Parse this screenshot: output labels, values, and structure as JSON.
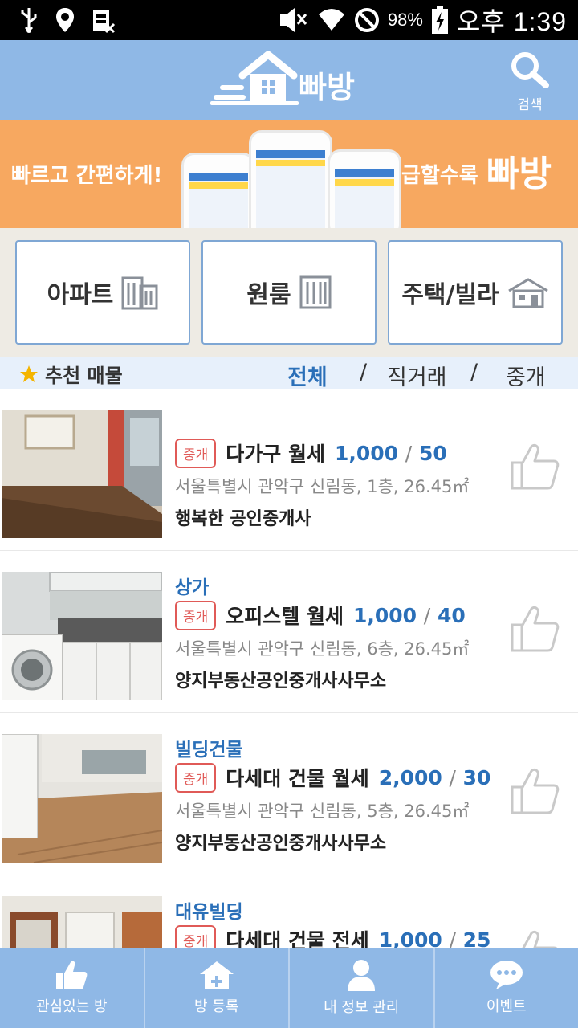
{
  "status_bar": {
    "battery": "98%",
    "time": "오후 1:39"
  },
  "header": {
    "logo_text": "빠방",
    "search_label": "검색"
  },
  "banner": {
    "left_text": "빠르고 간편하게!",
    "right_text": "급할수록",
    "brand": "빠방"
  },
  "categories": [
    {
      "label": "아파트"
    },
    {
      "label": "원룸"
    },
    {
      "label": "주택/빌라"
    }
  ],
  "filter": {
    "recommend_label": "추천 매물",
    "options": [
      "전체",
      "직거래",
      "중개"
    ],
    "active": "전체"
  },
  "listings": [
    {
      "building": "",
      "badge": "중개",
      "type": "다가구 월세",
      "deposit": "1,000",
      "rent": "50",
      "address": "서울특별시 관악구 신림동,   1층,   26.45㎡",
      "agent": "행복한 공인중개사"
    },
    {
      "building": "상가",
      "badge": "중개",
      "type": "오피스텔 월세",
      "deposit": "1,000",
      "rent": "40",
      "address": "서울특별시 관악구 신림동,   6층,   26.45㎡",
      "agent": "양지부동산공인중개사사무소"
    },
    {
      "building": "빌딩건물",
      "badge": "중개",
      "type": "다세대 건물 월세",
      "deposit": "2,000",
      "rent": "30",
      "address": "서울특별시 관악구 신림동,   5층,   26.45㎡",
      "agent": "양지부동산공인중개사사무소"
    },
    {
      "building": "대유빌딩",
      "badge": "중개",
      "type": "다세대 건물 전세",
      "deposit": "1,000",
      "rent": "25",
      "address": "",
      "agent": ""
    }
  ],
  "bottom_nav": [
    {
      "label": "관심있는 방",
      "icon": "thumbs-up-icon"
    },
    {
      "label": "방 등록",
      "icon": "house-plus-icon"
    },
    {
      "label": "내 정보 관리",
      "icon": "person-icon"
    },
    {
      "label": "이벤트",
      "icon": "chat-bubble-icon"
    }
  ],
  "colors": {
    "header": "#8fb8e6",
    "accent_blue": "#2a6fb8",
    "badge_red": "#e05a57",
    "banner_orange": "#f7a860"
  }
}
